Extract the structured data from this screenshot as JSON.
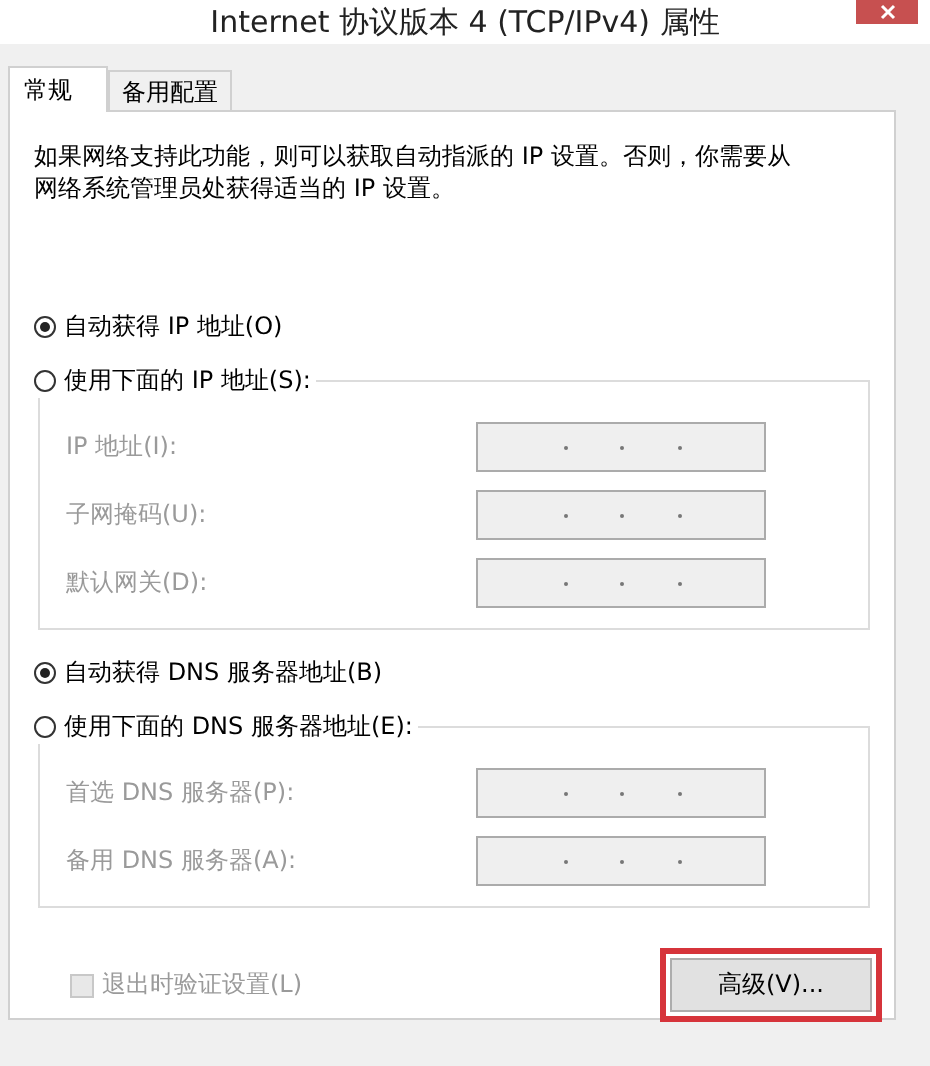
{
  "window": {
    "title": "Internet 协议版本 4 (TCP/IPv4) 属性"
  },
  "tabs": [
    {
      "label": "常规",
      "selected": true
    },
    {
      "label": "备用配置",
      "selected": false
    }
  ],
  "description": "如果网络支持此功能，则可以获取自动指派的 IP 设置。否则，你需要从网络系统管理员处获得适当的 IP 设置。",
  "ip_section": {
    "options": [
      {
        "label": "自动获得 IP 地址(O)",
        "selected": true
      },
      {
        "label": "使用下面的 IP 地址(S):",
        "selected": false
      }
    ],
    "fields": [
      {
        "label": "IP 地址(I):",
        "disabled": true
      },
      {
        "label": "子网掩码(U):",
        "disabled": true
      },
      {
        "label": "默认网关(D):",
        "disabled": true
      }
    ]
  },
  "dns_section": {
    "options": [
      {
        "label": "自动获得 DNS 服务器地址(B)",
        "selected": true
      },
      {
        "label": "使用下面的 DNS 服务器地址(E):",
        "selected": false
      }
    ],
    "fields": [
      {
        "label": "首选 DNS 服务器(P):",
        "disabled": true
      },
      {
        "label": "备用 DNS 服务器(A):",
        "disabled": true
      }
    ]
  },
  "validate_checkbox": {
    "label": "退出时验证设置(L)",
    "checked": false,
    "disabled": true
  },
  "advanced_button": {
    "label": "高级(V)...",
    "highlighted": true
  }
}
